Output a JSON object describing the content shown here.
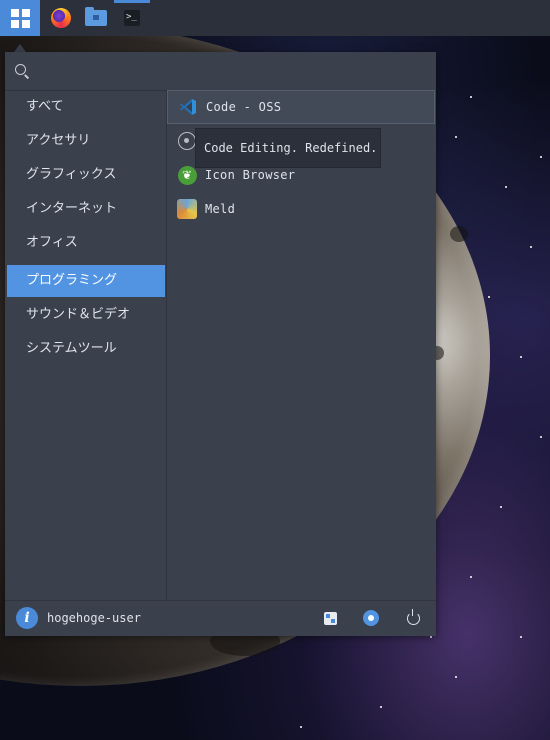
{
  "taskbar": {
    "apps": [
      "app-menu",
      "firefox",
      "files",
      "terminal"
    ],
    "accent": "#4a8ad8"
  },
  "search": {
    "value": "",
    "placeholder": ""
  },
  "categories": [
    {
      "label": "すべて"
    },
    {
      "label": "アクセサリ"
    },
    {
      "label": "グラフィックス"
    },
    {
      "label": "インターネット"
    },
    {
      "label": "オフィス"
    },
    {
      "label": "プログラミング",
      "selected": true
    },
    {
      "label": "サウンド＆ビデオ"
    },
    {
      "label": "システムツール"
    }
  ],
  "apps": [
    {
      "label": "Code - OSS",
      "icon": "vscode-icon",
      "hovered": true
    },
    {
      "label": "",
      "icon": "atom-icon"
    },
    {
      "label": "Icon Browser",
      "icon": "icon-browser-icon"
    },
    {
      "label": "Meld",
      "icon": "meld-icon"
    }
  ],
  "tooltip": {
    "text": "Code Editing. Redefined."
  },
  "footer": {
    "username": "hogehoge-user",
    "avatar_glyph": "i",
    "buttons": [
      "settings-icon",
      "lock-icon",
      "power-icon"
    ]
  },
  "colors": {
    "menu_bg": "#3a404c",
    "selected": "#5294e2",
    "taskbar_bg": "#2b303b"
  }
}
